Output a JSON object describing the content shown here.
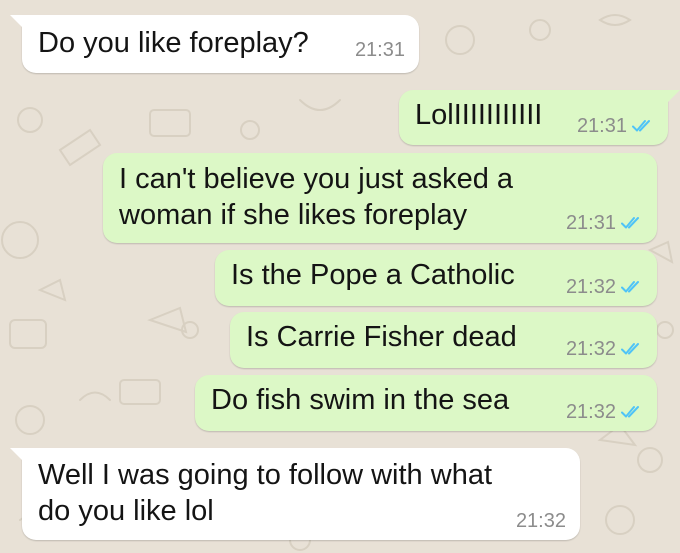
{
  "chat": {
    "messages": [
      {
        "direction": "incoming",
        "text": "Do you like foreplay?",
        "time": "21:31"
      },
      {
        "direction": "outgoing",
        "text": "LolIIIIIIIIIII",
        "time": "21:31",
        "status": "read-double-check-icon"
      },
      {
        "direction": "outgoing",
        "lines": [
          "I can't believe you just asked a",
          "woman if she likes foreplay"
        ],
        "time": "21:31",
        "status": "read-double-check-icon"
      },
      {
        "direction": "outgoing",
        "text": "Is the Pope a Catholic",
        "time": "21:32",
        "status": "read-double-check-icon"
      },
      {
        "direction": "outgoing",
        "text": "Is Carrie Fisher dead",
        "time": "21:32",
        "status": "read-double-check-icon"
      },
      {
        "direction": "outgoing",
        "text": "Do fish swim in the sea",
        "time": "21:32",
        "status": "read-double-check-icon"
      },
      {
        "direction": "incoming",
        "lines": [
          "Well I was going to follow with what",
          "do you like lol"
        ],
        "time": "21:32"
      }
    ]
  },
  "colors": {
    "wallpaper": "#e8e1d6",
    "incoming_bubble": "#ffffff",
    "outgoing_bubble": "#dcf8c6",
    "read_ticks": "#4fc3f7",
    "timestamp": "#8c8c8c"
  }
}
